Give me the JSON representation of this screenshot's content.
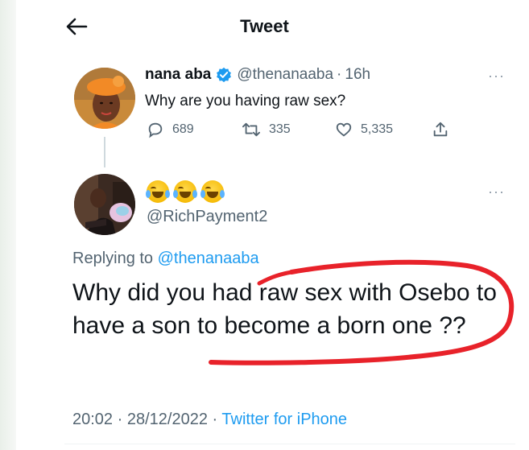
{
  "header": {
    "title": "Tweet"
  },
  "original_tweet": {
    "name": "nana aba",
    "handle": "@thenanaaba",
    "separator": "·",
    "time": "16h",
    "text": "Why are you having raw sex?",
    "stats": {
      "replies": "689",
      "retweets": "335",
      "likes": "5,335"
    }
  },
  "reply_tweet": {
    "name_emojis": "😂😂😂",
    "handle": "@RichPayment2",
    "replying_to_label": "Replying to",
    "replying_to_handle": "@thenanaaba",
    "text": "Why did you had raw sex with Osebo to have a son to become a born one ??",
    "time": "20:02",
    "date": "28/12/2022",
    "separator": "·",
    "source": "Twitter for iPhone"
  },
  "more_label": "···",
  "colors": {
    "accent": "#1d9bf0",
    "text": "#0f1419",
    "secondary": "#536471",
    "annotation": "#e8222a"
  }
}
